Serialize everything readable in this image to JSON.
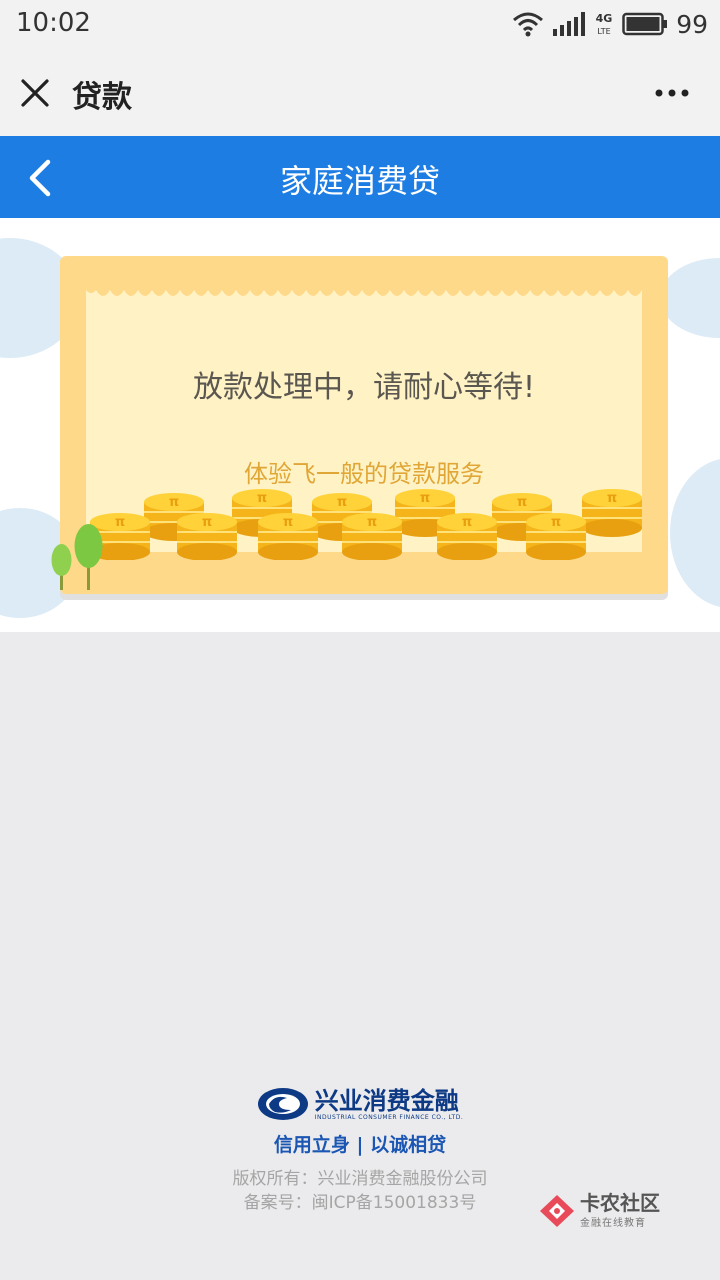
{
  "status_bar": {
    "time": "10:02",
    "network": "4G LTE",
    "battery": "99"
  },
  "nav": {
    "title": "贷款"
  },
  "header": {
    "title": "家庭消费贷"
  },
  "banner": {
    "message": "放款处理中，请耐心等待!",
    "subtitle": "体验飞一般的贷款服务"
  },
  "footer": {
    "logo_cn": "兴业消费金融",
    "logo_en": "INDUSTRIAL CONSUMER FINANCE CO., LTD.",
    "slogan": "信用立身 | 以诚相贷",
    "copyright": "版权所有：兴业消费金融股份公司",
    "icp": "备案号：闽ICP备15001833号"
  },
  "watermark": {
    "title": "卡农社区",
    "subtitle": "金融在线教育"
  }
}
